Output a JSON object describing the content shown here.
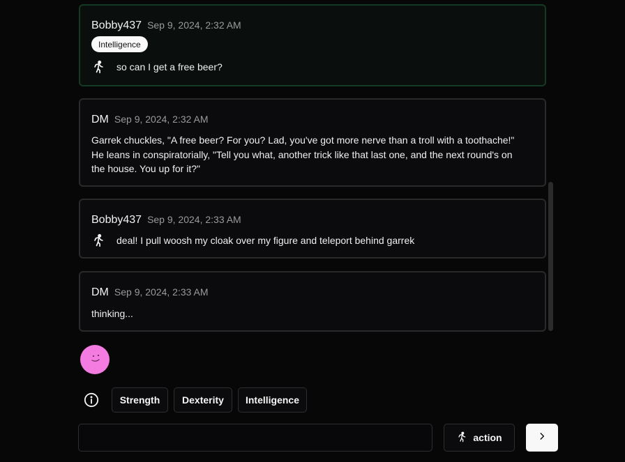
{
  "messages": [
    {
      "author": "Bobby437",
      "time": "Sep 9, 2024, 2:32 AM",
      "tag": "Intelligence",
      "icon": "running-person-icon",
      "text": "so can I get a free beer?"
    },
    {
      "author": "DM",
      "time": "Sep 9, 2024, 2:32 AM",
      "text": "Garrek chuckles, \"A free beer? For you? Lad, you've got more nerve than a troll with a toothache!\" He leans in conspiratorially, \"Tell you what, another trick like that last one, and the next round's on the house. You up for it?\""
    },
    {
      "author": "Bobby437",
      "time": "Sep 9, 2024, 2:33 AM",
      "icon": "running-person-icon",
      "text": "deal! I pull woosh my cloak over my figure and teleport behind garrek"
    },
    {
      "author": "DM",
      "time": "Sep 9, 2024, 2:33 AM",
      "text": "thinking..."
    }
  ],
  "controls": {
    "info_icon": "info-icon",
    "stat_buttons": [
      "Strength",
      "Dexterity",
      "Intelligence"
    ],
    "chat_input_value": "",
    "action_label": "action",
    "send_icon": "chevron-right-icon"
  },
  "colors": {
    "background": "#070708",
    "avatar": "#f47be0",
    "highlight_border": "#123a24"
  }
}
